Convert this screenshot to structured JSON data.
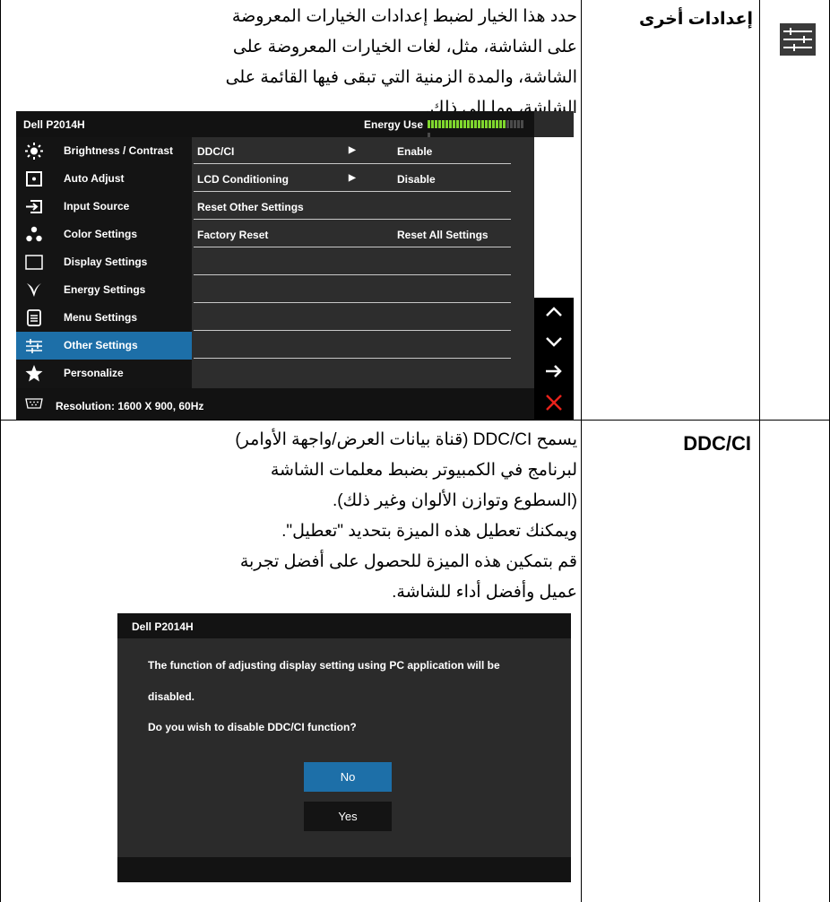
{
  "row1": {
    "title": "إعدادات أخرى",
    "icon": "sliders-icon",
    "description": "حدد هذا الخيار لضبط إعدادات الخيارات المعروضة على الشاشة، مثل، لغات الخيارات المعروضة على الشاشة، والمدة الزمنية التي تبقى فيها القائمة على الشاشة، وما إلى ذلك."
  },
  "osd": {
    "model": "Dell P2014H",
    "energy_label": "Energy Use",
    "energy_level": 0.8,
    "menu": [
      {
        "label": "Brightness / Contrast",
        "icon": "brightness-icon"
      },
      {
        "label": "Auto Adjust",
        "icon": "auto-adjust-icon"
      },
      {
        "label": "Input Source",
        "icon": "input-source-icon"
      },
      {
        "label": "Color Settings",
        "icon": "color-settings-icon"
      },
      {
        "label": "Display Settings",
        "icon": "display-settings-icon"
      },
      {
        "label": "Energy Settings",
        "icon": "energy-settings-icon"
      },
      {
        "label": "Menu Settings",
        "icon": "menu-settings-icon"
      },
      {
        "label": "Other Settings",
        "icon": "other-settings-icon",
        "selected": true
      },
      {
        "label": "Personalize",
        "icon": "star-icon"
      }
    ],
    "options": [
      {
        "label": "DDC/CI",
        "arrow": "▶",
        "value": "Enable"
      },
      {
        "label": "LCD Conditioning",
        "arrow": "▶",
        "value": "Disable"
      },
      {
        "label": "Reset Other Settings",
        "arrow": "",
        "value": ""
      },
      {
        "label": "Factory Reset",
        "arrow": "",
        "value": "Reset All Settings"
      }
    ],
    "footer": "Resolution: 1600 X 900, 60Hz",
    "nav_buttons": [
      "up-icon",
      "down-icon",
      "right-arrow-icon",
      "close-icon"
    ],
    "colors": {
      "selected": "#1d6fa8",
      "energy": "#7fd62e",
      "close": "#e8221b"
    }
  },
  "row2": {
    "title": "DDC/CI",
    "paragraphs": [
      "يسمح DDC/CI (قناة بيانات العرض/واجهة الأوامر) لبرنامج في الكمبيوتر بضبط معلمات الشاشة (السطوع وتوازن الألوان وغير ذلك).",
      "ويمكنك تعطيل هذه الميزة بتحديد \"تعطيل\".",
      "قم بتمكين هذه الميزة للحصول على أفضل تجربة عميل وأفضل أداء للشاشة."
    ]
  },
  "dialog": {
    "title": "Dell P2014H",
    "line1": "The function of adjusting display setting using PC application will be",
    "line2": "disabled.",
    "question": "Do you wish to disable DDC/CI function?",
    "no_label": "No",
    "yes_label": "Yes"
  }
}
